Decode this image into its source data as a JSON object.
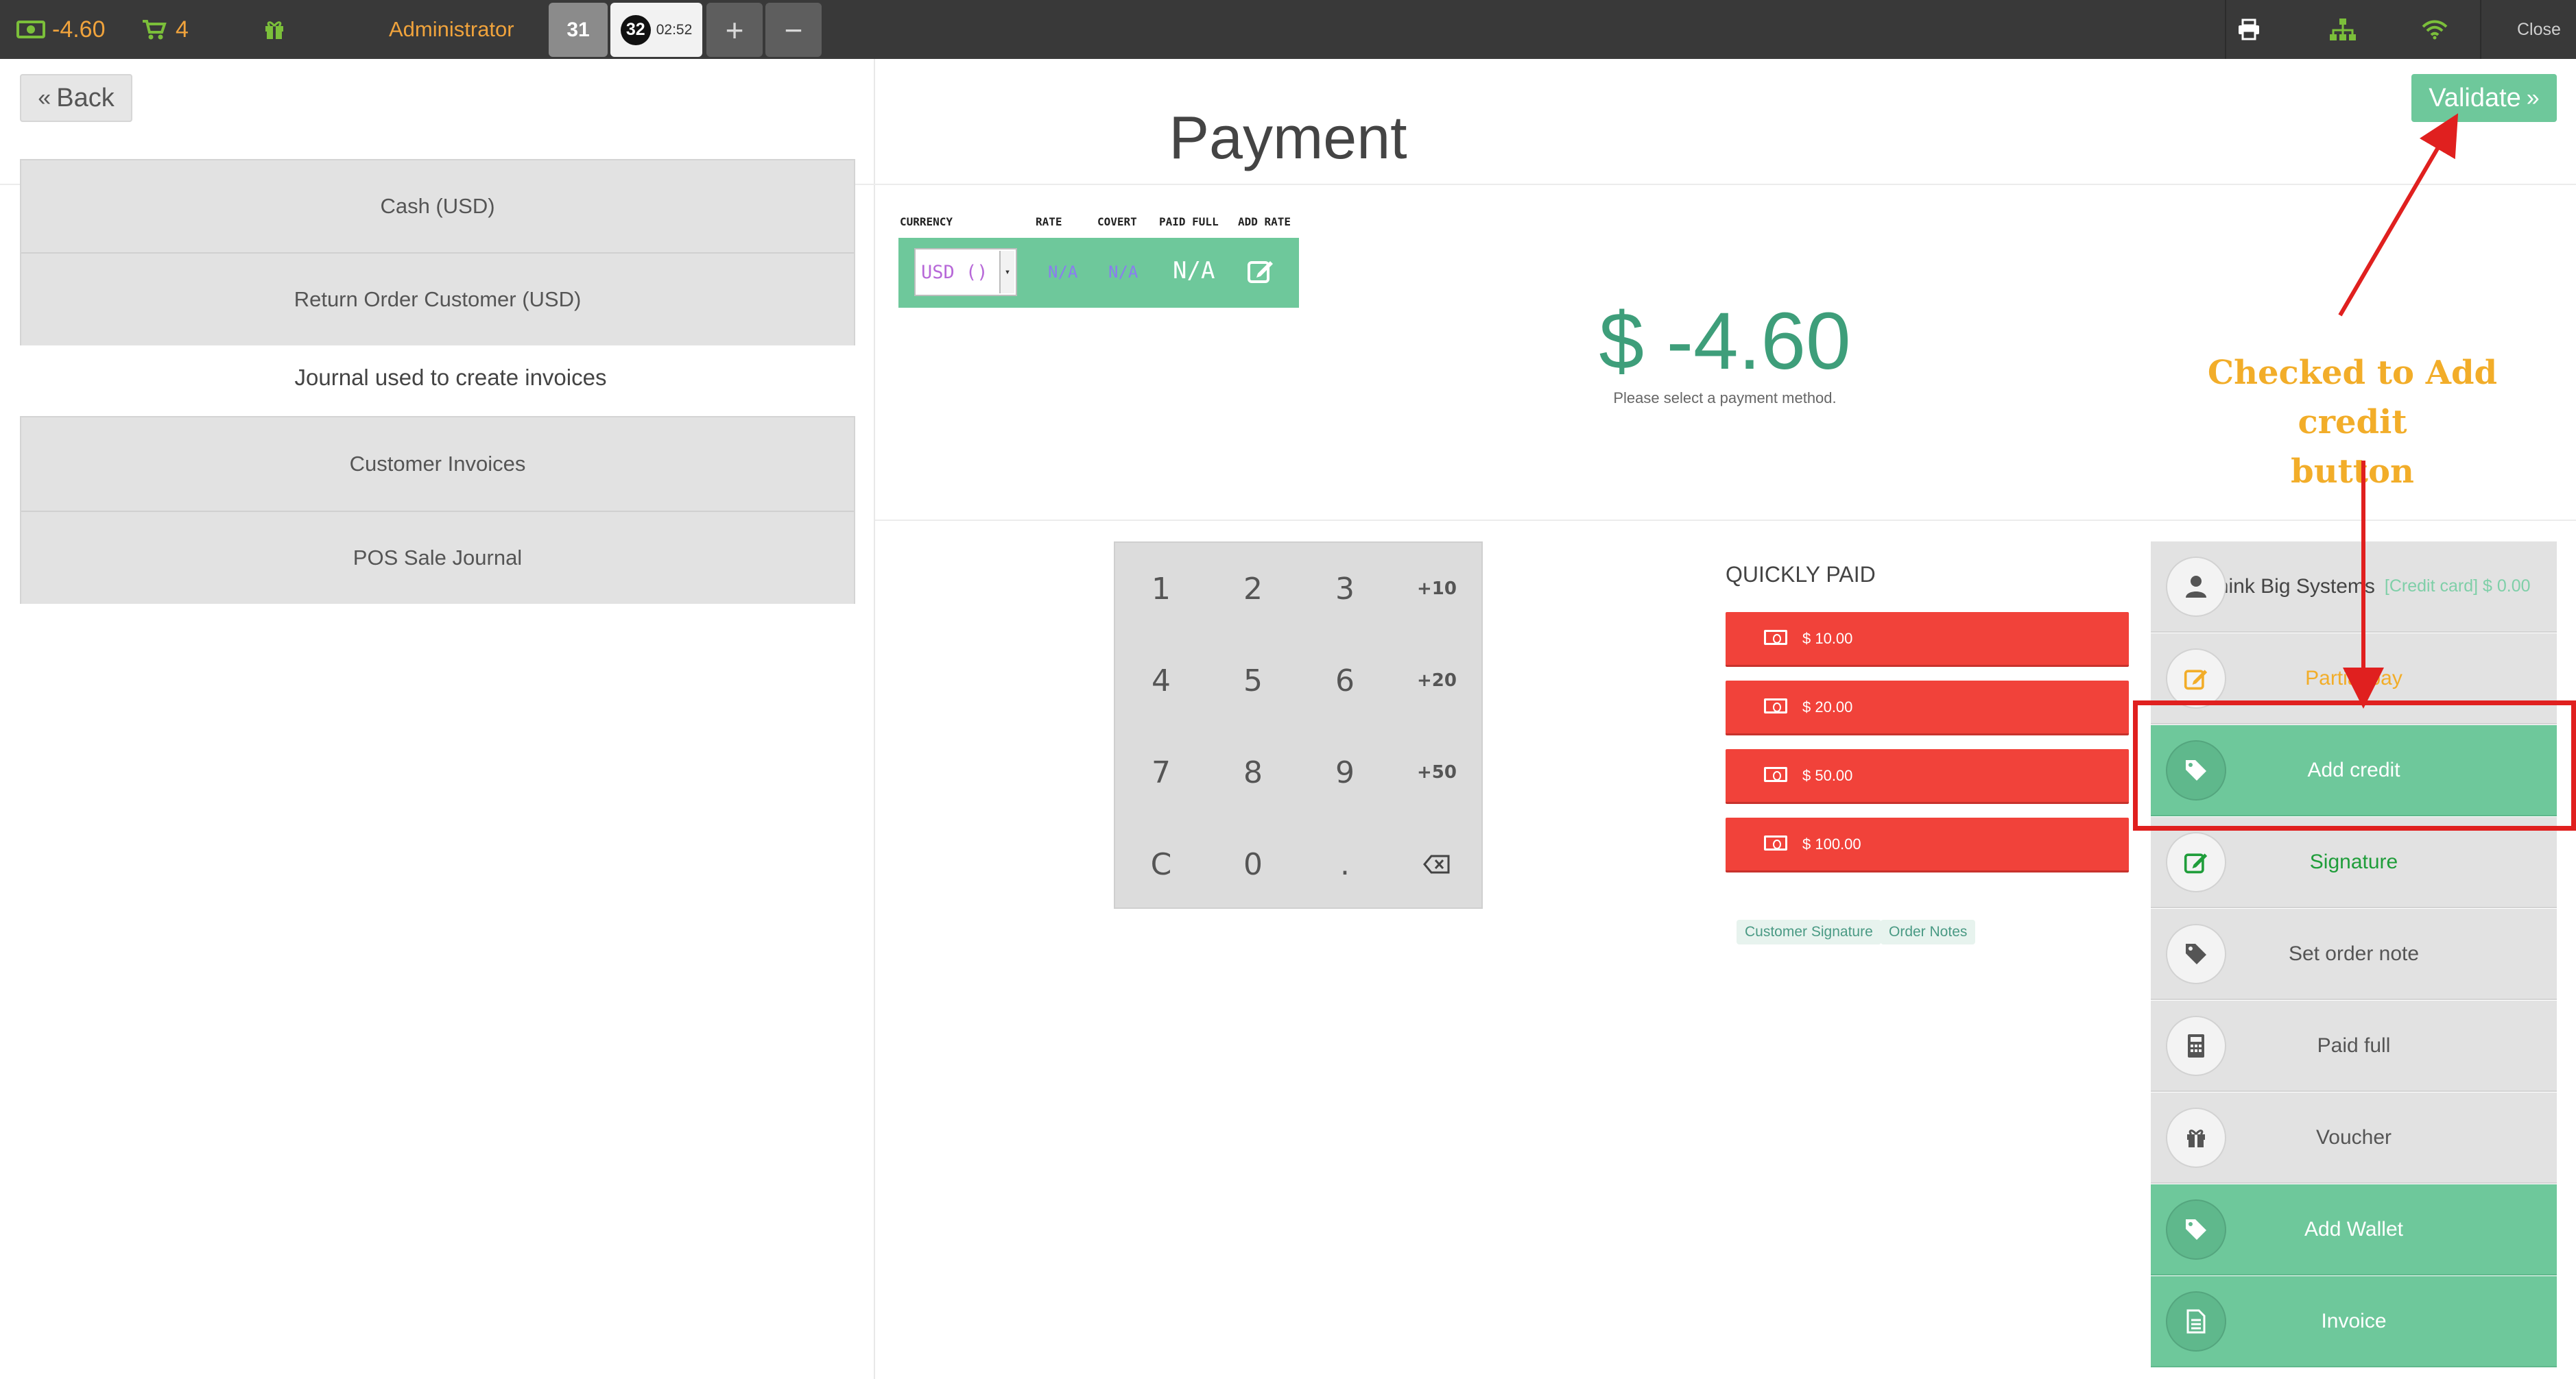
{
  "topbar": {
    "balance": "-4.60",
    "cart_count": "4",
    "user": "Administrator",
    "order_tab_a": "31",
    "order_tab_b_num": "32",
    "order_tab_b_time": "02:52",
    "add_order": "+",
    "remove_order": "−",
    "close": "Close",
    "colors": {
      "bar": "#393939",
      "accent_orange": "#f0a33c",
      "accent_green": "#7bbf3a"
    },
    "icons": [
      "money-icon",
      "cart-icon",
      "gift-icon",
      "print-icon",
      "network-icon",
      "wifi-icon"
    ]
  },
  "page": {
    "back": "Back",
    "title": "Payment",
    "validate": "Validate"
  },
  "payment_methods": {
    "group1": [
      "Cash (USD)",
      "Return Order Customer (USD)"
    ],
    "journal_label": "Journal used to create invoices",
    "group2": [
      "Customer Invoices",
      "POS Sale Journal"
    ]
  },
  "currency": {
    "headers": {
      "currency": "CURRENCY",
      "rate": "RATE",
      "covert": "COVERT",
      "paid_full": "PAID FULL",
      "add_rate": "ADD RATE"
    },
    "selected": "USD ()",
    "rate": "N/A",
    "covert": "N/A",
    "paid": "N/A"
  },
  "amount": {
    "value": "$ -4.60",
    "hint": "Please select a payment method."
  },
  "numpad": {
    "keys": [
      "1",
      "2",
      "3",
      "+10",
      "4",
      "5",
      "6",
      "+20",
      "7",
      "8",
      "9",
      "+50",
      "C",
      "0",
      "."
    ]
  },
  "quickly_paid": {
    "title": "QUICKLY PAID",
    "amounts": [
      "$ 10.00",
      "$ 20.00",
      "$ 50.00",
      "$ 100.00"
    ],
    "tags": [
      "Customer Signature",
      "Order Notes"
    ]
  },
  "actions": {
    "customer_name": "Think Big Systems",
    "customer_credit": "[Credit card] $ 0.00",
    "partial_pay": "Partial pay",
    "add_credit": "Add credit",
    "signature": "Signature",
    "set_order_note": "Set order note",
    "paid_full": "Paid full",
    "voucher": "Voucher",
    "add_wallet": "Add Wallet",
    "invoice": "Invoice"
  },
  "annotation": {
    "line1": "Checked to Add credit",
    "line2": "button",
    "color": "#f2ad29",
    "box_color": "#e0201f"
  }
}
